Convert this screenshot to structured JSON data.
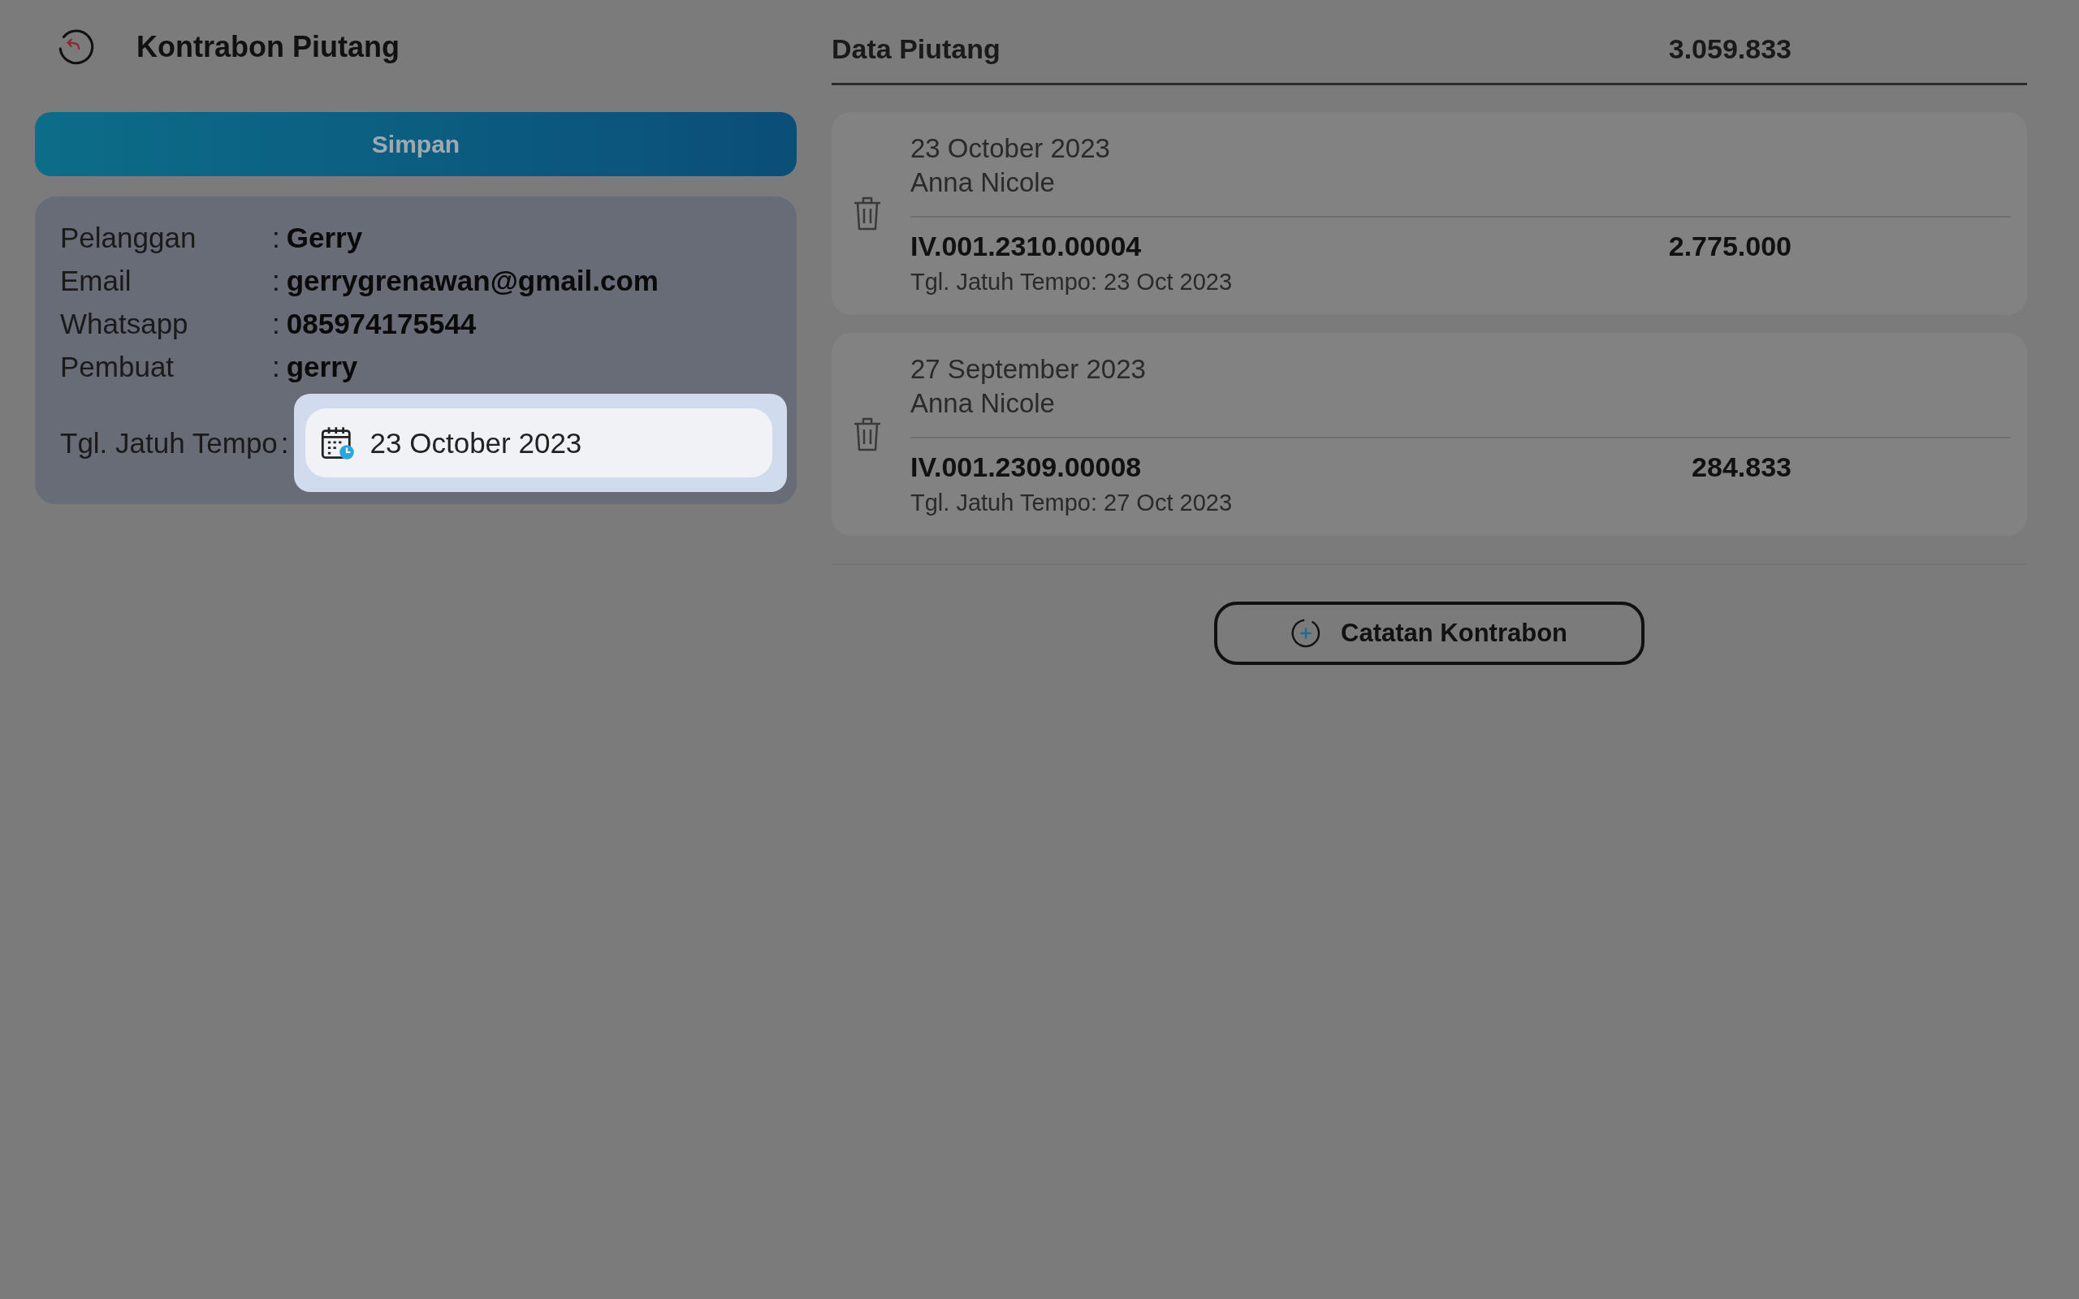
{
  "title": "Kontrabon Piutang",
  "save_button": "Simpan",
  "customer": {
    "fields": [
      {
        "label": "Pelanggan",
        "separator": ":",
        "value": "Gerry"
      },
      {
        "label": "Email",
        "separator": ":",
        "value": "gerrygrenawan@gmail.com"
      },
      {
        "label": "Whatsapp",
        "separator": ":",
        "value": "085974175544"
      },
      {
        "label": "Pembuat",
        "separator": ":",
        "value": "gerry"
      }
    ],
    "due_date": {
      "label": "Tgl. Jatuh Tempo",
      "separator": ":",
      "value": "23 October 2023"
    }
  },
  "receivables": {
    "title": "Data Piutang",
    "total": "3.059.833",
    "items": [
      {
        "date": "23 October 2023",
        "name": "Anna Nicole",
        "invoice": "IV.001.2310.00004",
        "amount": "2.775.000",
        "due": "Tgl. Jatuh Tempo: 23 Oct 2023"
      },
      {
        "date": "27 September 2023",
        "name": "Anna Nicole",
        "invoice": "IV.001.2309.00008",
        "amount": "284.833",
        "due": "Tgl. Jatuh Tempo: 27 Oct 2023"
      }
    ]
  },
  "add_button": "Catatan Kontrabon"
}
